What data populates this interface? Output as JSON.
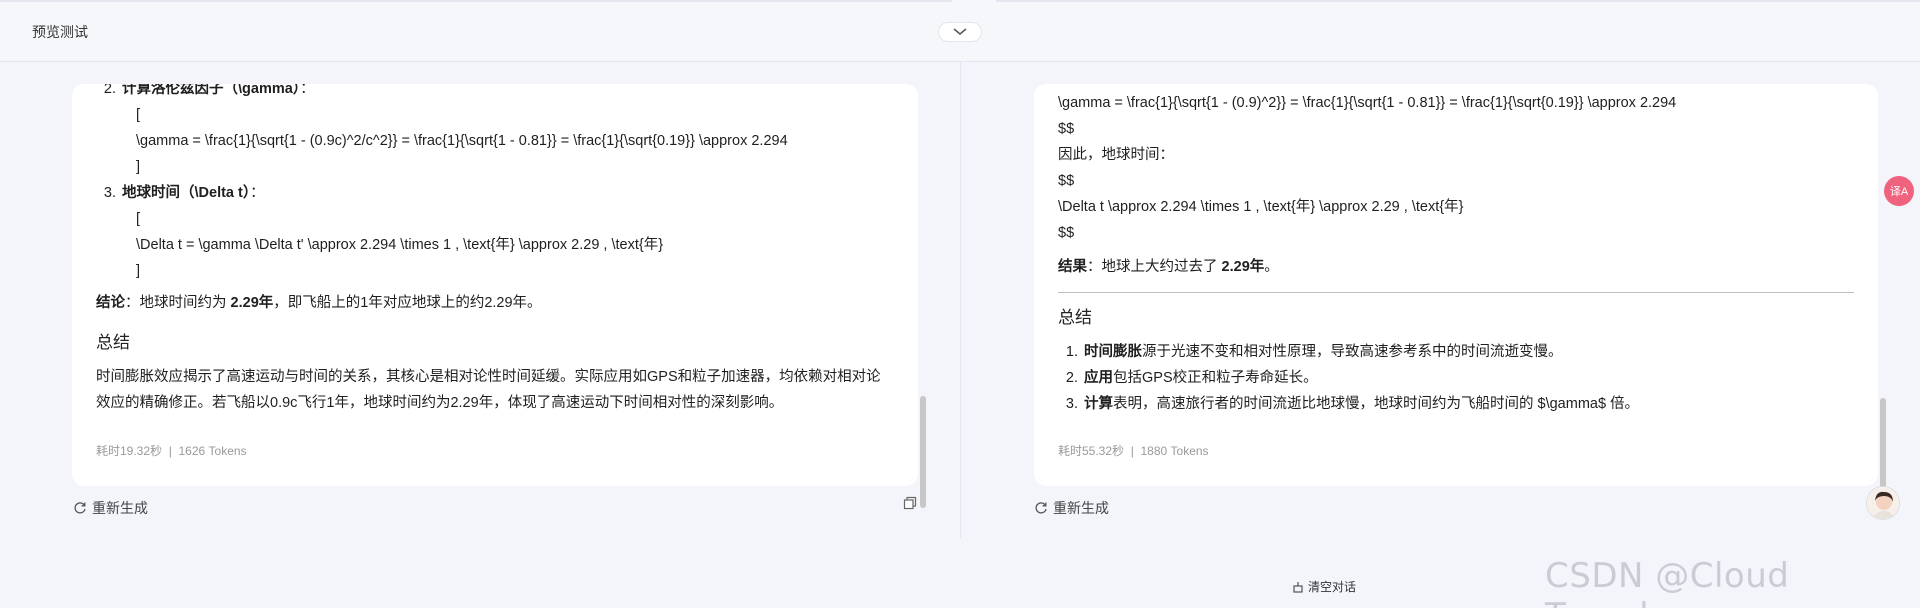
{
  "topbar": {
    "title": "预览测试"
  },
  "left": {
    "item2_label": "计算洛伦兹因子（\\gamma）",
    "item2_tail": "：",
    "bracket_open": "[",
    "gamma_formula": "\\gamma = \\frac{1}{\\sqrt{1 - (0.9c)^2/c^2}} = \\frac{1}{\\sqrt{1 - 0.81}} = \\frac{1}{\\sqrt{0.19}} \\approx 2.294",
    "bracket_close": "]",
    "item3_label": "地球时间（\\Delta t）",
    "item3_tail": "：",
    "delta_formula": "\\Delta t = \\gamma \\Delta t' \\approx 2.294 \\times 1 , \\text{年} \\approx 2.29 , \\text{年}",
    "conclusion_label": "结论",
    "conclusion_prefix": "：地球时间约为 ",
    "conclusion_value": "2.29年",
    "conclusion_suffix": "，即飞船上的1年对应地球上的约2.29年。",
    "summary_heading": "总结",
    "summary_text": "时间膨胀效应揭示了高速运动与时间的关系，其核心是相对论性时间延缓。实际应用如GPS和粒子加速器，均依赖对相对论效应的精确修正。若飞船以0.9c飞行1年，地球时间约为2.29年，体现了高速运动下时间相对性的深刻影响。",
    "meta_time": "耗时19.32秒",
    "meta_sep": "|",
    "meta_tokens": "1626 Tokens",
    "regenerate": "重新生成",
    "num2": "2.",
    "num3": "3."
  },
  "right": {
    "gamma_formula": "\\gamma = \\frac{1}{\\sqrt{1 - (0.9)^2}} = \\frac{1}{\\sqrt{1 - 0.81}} = \\frac{1}{\\sqrt{0.19}} \\approx 2.294",
    "dollars1": "$$",
    "therefore": "因此，地球时间：",
    "dollars2": "$$",
    "delta_formula": "\\Delta t \\approx 2.294 \\times 1 , \\text{年} \\approx 2.29 , \\text{年}",
    "dollars3": "$$",
    "result_label": "结果",
    "result_prefix": "：地球上大约过去了 ",
    "result_value": "2.29年",
    "result_suffix": "。",
    "summary_heading": "总结",
    "items": [
      {
        "num": "1.",
        "bold": "时间膨胀",
        "text": "源于光速不变和相对性原理，导致高速参考系中的时间流逝变慢。"
      },
      {
        "num": "2.",
        "bold": "应用",
        "text": "包括GPS校正和粒子寿命延长。"
      },
      {
        "num": "3.",
        "bold": "计算",
        "text": "表明，高速旅行者的时间流逝比地球慢，地球时间约为飞船时间的 $\\gamma$ 倍。"
      }
    ],
    "meta_time": "耗时55.32秒",
    "meta_sep": "|",
    "meta_tokens": "1880 Tokens",
    "regenerate": "重新生成"
  },
  "footer": {
    "clear": "清空对话"
  },
  "watermark": "CSDN @Cloud Traveler",
  "translate_badge": "译A"
}
